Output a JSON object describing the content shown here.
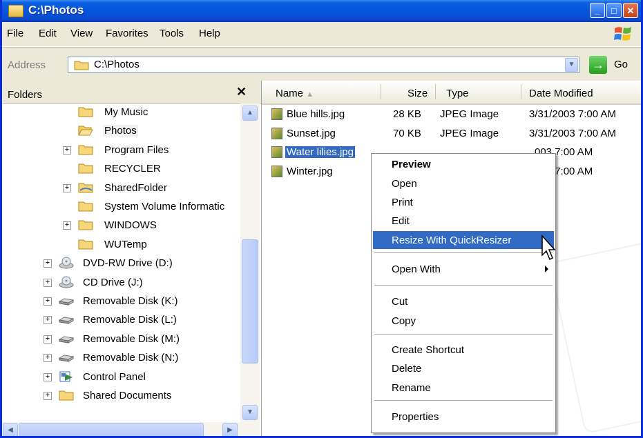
{
  "window": {
    "title": "C:\\Photos",
    "controls": [
      "minimize",
      "maximize",
      "close"
    ]
  },
  "menubar": {
    "items": [
      {
        "label": "File"
      },
      {
        "label": "Edit"
      },
      {
        "label": "View"
      },
      {
        "label": "Favorites"
      },
      {
        "label": "Tools"
      },
      {
        "label": "Help"
      }
    ]
  },
  "addressbar": {
    "label": "Address",
    "value": "C:\\Photos",
    "go_label": "Go"
  },
  "folders": {
    "title": "Folders",
    "close_glyph": "✕",
    "items": [
      {
        "label": "My Music",
        "icon": "folder-icon",
        "expander": false
      },
      {
        "label": "Photos",
        "icon": "folder-open-icon",
        "expander": false,
        "selected": true
      },
      {
        "label": "Program Files",
        "icon": "folder-icon",
        "expander": true
      },
      {
        "label": "RECYCLER",
        "icon": "folder-icon",
        "expander": false
      },
      {
        "label": "SharedFolder",
        "icon": "shared-folder-icon",
        "expander": true
      },
      {
        "label": "System Volume Informatic",
        "icon": "folder-icon",
        "expander": false
      },
      {
        "label": "WINDOWS",
        "icon": "folder-icon",
        "expander": true
      },
      {
        "label": "WUTemp",
        "icon": "folder-icon",
        "expander": false
      },
      {
        "label": "DVD-RW Drive (D:)",
        "icon": "optical-drive-icon",
        "expander": true
      },
      {
        "label": "CD Drive (J:)",
        "icon": "optical-drive-icon",
        "expander": true
      },
      {
        "label": "Removable Disk (K:)",
        "icon": "removable-disk-icon",
        "expander": true
      },
      {
        "label": "Removable Disk (L:)",
        "icon": "removable-disk-icon",
        "expander": true
      },
      {
        "label": "Removable Disk (M:)",
        "icon": "removable-disk-icon",
        "expander": true
      },
      {
        "label": "Removable Disk (N:)",
        "icon": "removable-disk-icon",
        "expander": true
      },
      {
        "label": "Control Panel",
        "icon": "control-panel-icon",
        "expander": true
      },
      {
        "label": "Shared Documents",
        "icon": "folder-icon",
        "expander": true
      }
    ]
  },
  "filelist": {
    "columns": [
      {
        "label": "Name",
        "sort_glyph": "▲"
      },
      {
        "label": "Size"
      },
      {
        "label": "Type"
      },
      {
        "label": "Date Modified"
      }
    ],
    "rows": [
      {
        "name": "Blue hills.jpg",
        "size": "28 KB",
        "type": "JPEG Image",
        "date": "3/31/2003 7:00 AM"
      },
      {
        "name": "Sunset.jpg",
        "size": "70 KB",
        "type": "JPEG Image",
        "date": "3/31/2003 7:00 AM"
      },
      {
        "name": "Water lilies.jpg",
        "size": "",
        "type": "",
        "date": "003 7:00 AM",
        "selected": true
      },
      {
        "name": "Winter.jpg",
        "size": "",
        "type": "",
        "date": "003 7:00 AM"
      }
    ]
  },
  "context_menu": {
    "items": [
      {
        "label": "Preview",
        "bold": true
      },
      {
        "label": "Open"
      },
      {
        "label": "Print"
      },
      {
        "label": "Edit"
      },
      {
        "label": "Resize With QuickResizer",
        "highlighted": true
      },
      {
        "label": "Open With",
        "submenu": true
      },
      {
        "label": "Cut"
      },
      {
        "label": "Copy"
      },
      {
        "label": "Create Shortcut"
      },
      {
        "label": "Delete"
      },
      {
        "label": "Rename"
      },
      {
        "label": "Properties"
      }
    ]
  },
  "colors": {
    "titlebar_blue": "#0655dc",
    "selection_blue": "#316ac5",
    "chrome": "#ece9d8"
  }
}
